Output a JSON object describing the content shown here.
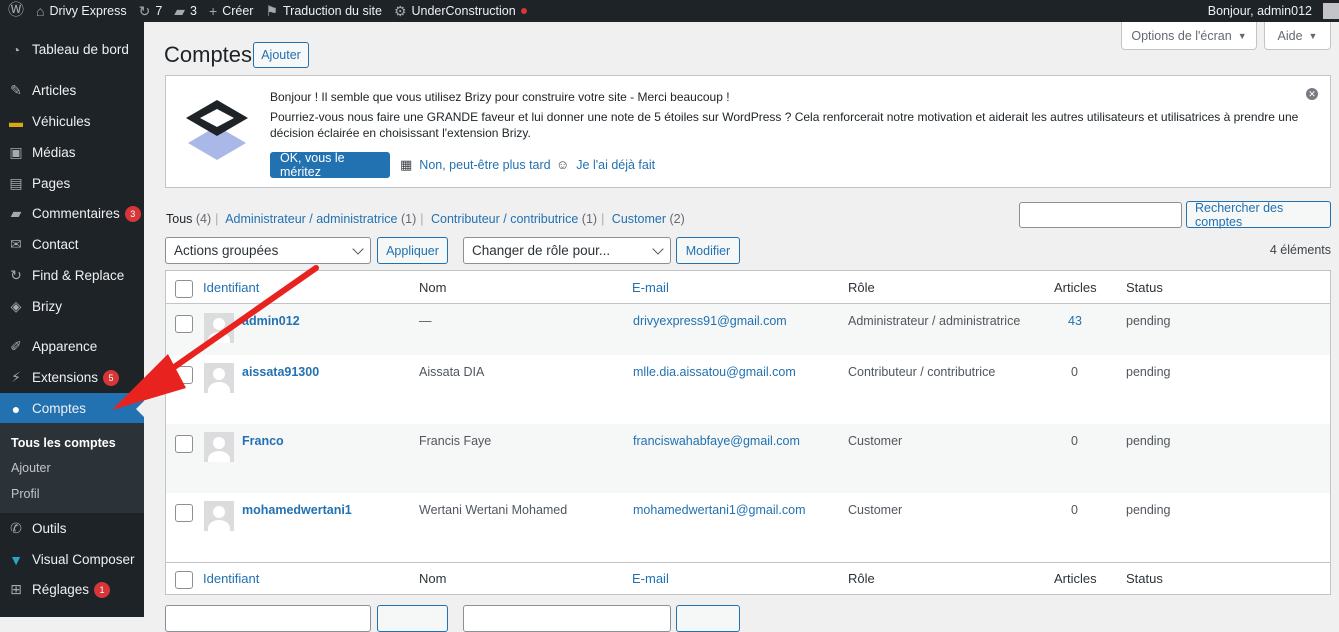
{
  "adminbar": {
    "site_name": "Drivy Express",
    "updates_count": "7",
    "comments_count": "3",
    "new_label": "Créer",
    "translate_label": "Traduction du site",
    "under_construction_label": "UnderConstruction",
    "greeting": "Bonjour, admin012"
  },
  "sidebar": {
    "items": [
      {
        "label": "Tableau de bord",
        "icon": "dashboard-icon"
      },
      {
        "label": "Articles",
        "icon": "pin-icon"
      },
      {
        "label": "Véhicules",
        "icon": "car-icon"
      },
      {
        "label": "Médias",
        "icon": "media-icon"
      },
      {
        "label": "Pages",
        "icon": "pages-icon"
      },
      {
        "label": "Commentaires",
        "icon": "comment-icon",
        "badge": "3"
      },
      {
        "label": "Contact",
        "icon": "mail-icon"
      },
      {
        "label": "Find & Replace",
        "icon": "refresh-icon"
      },
      {
        "label": "Brizy",
        "icon": "brizy-icon"
      },
      {
        "label": "Apparence",
        "icon": "brush-icon"
      },
      {
        "label": "Extensions",
        "icon": "plugin-icon",
        "badge": "5"
      },
      {
        "label": "Comptes",
        "icon": "user-icon"
      },
      {
        "label": "Outils",
        "icon": "wrench-icon"
      },
      {
        "label": "Visual Composer",
        "icon": "vc-icon"
      },
      {
        "label": "Réglages",
        "icon": "settings-icon",
        "badge": "1"
      }
    ],
    "submenu": [
      "Tous les comptes",
      "Ajouter",
      "Profil"
    ]
  },
  "screen_options_label": "Options de l'écran",
  "help_label": "Aide",
  "page": {
    "title": "Comptes",
    "add_button": "Ajouter"
  },
  "notice": {
    "line1": "Bonjour ! Il semble que vous utilisez Brizy pour construire votre site - Merci beaucoup !",
    "line2": "Pourriez-vous nous faire une GRANDE faveur et lui donner une note de 5 étoiles sur WordPress ? Cela renforcerait notre motivation et aiderait les autres utilisateurs et utilisatrices à prendre une",
    "line3": "décision éclairée en choisissant l'extension Brizy.",
    "ok_button": "OK, vous le méritez",
    "later_link": "Non, peut-être plus tard",
    "done_link": "Je l'ai déjà fait"
  },
  "filters": {
    "all_label": "Tous",
    "all_count": "(4)",
    "admin_label": "Administrateur / administratrice",
    "admin_count": "(1)",
    "contrib_label": "Contributeur / contributrice",
    "contrib_count": "(1)",
    "customer_label": "Customer",
    "customer_count": "(2)"
  },
  "search_button": "Rechercher des comptes",
  "bulk_actions": "Actions groupées",
  "apply_button": "Appliquer",
  "change_role": "Changer de rôle pour...",
  "modify_button": "Modifier",
  "items_count": "4 éléments",
  "table": {
    "columns": {
      "username": "Identifiant",
      "name": "Nom",
      "email": "E-mail",
      "role": "Rôle",
      "posts": "Articles",
      "status": "Status"
    },
    "rows": [
      {
        "username": "admin012",
        "name": "—",
        "email": "drivyexpress91@gmail.com",
        "role": "Administrateur / administratrice",
        "posts": "43",
        "status": "pending"
      },
      {
        "username": "aissata91300",
        "name": "Aissata DIA",
        "email": "mlle.dia.aissatou@gmail.com",
        "role": "Contributeur / contributrice",
        "posts": "0",
        "status": "pending"
      },
      {
        "username": "Franco",
        "name": "Francis Faye",
        "email": "franciswahabfaye@gmail.com",
        "role": "Customer",
        "posts": "0",
        "status": "pending"
      },
      {
        "username": "mohamedwertani1",
        "name": "Wertani Wertani Mohamed",
        "email": "mohamedwertani1@gmail.com",
        "role": "Customer",
        "posts": "0",
        "status": "pending"
      }
    ]
  },
  "colors": {
    "admin_dark": "#1d2327",
    "accent": "#2271b1",
    "badge": "#d63638",
    "annotation_arrow": "#e8231f"
  }
}
